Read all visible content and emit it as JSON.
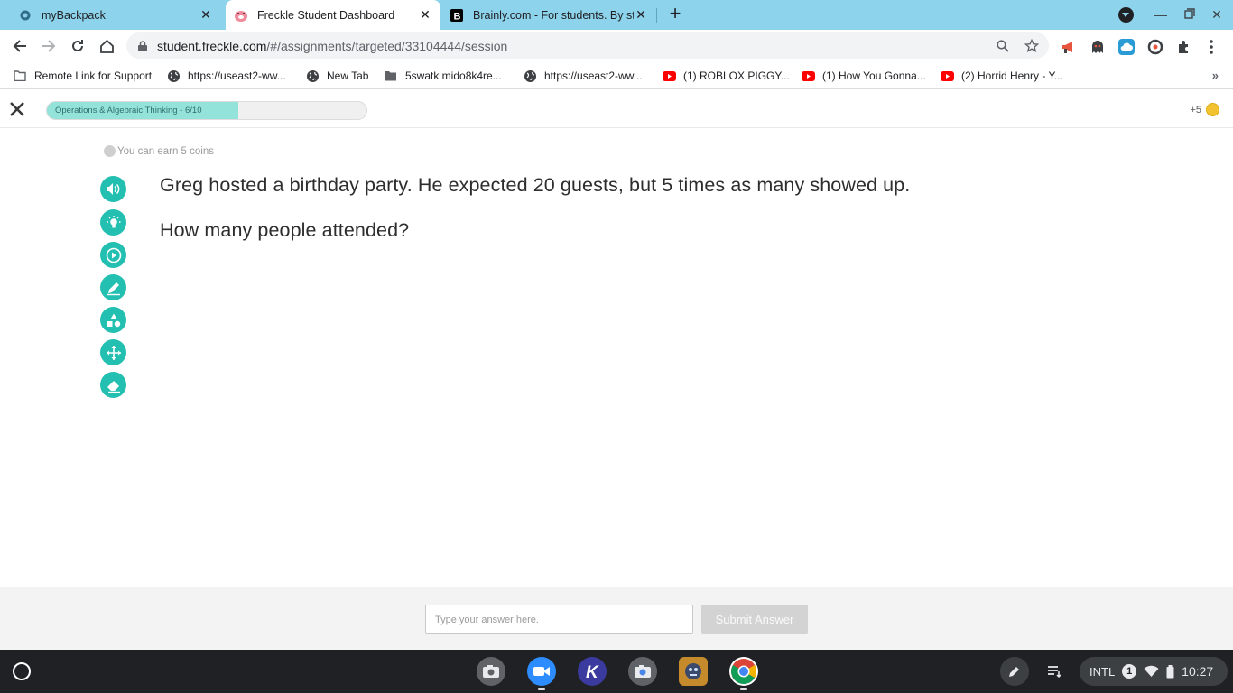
{
  "tabs": [
    {
      "title": "myBackpack",
      "icon": "backpack-favicon",
      "active": false
    },
    {
      "title": "Freckle Student Dashboard",
      "icon": "freckle-pig-favicon",
      "active": true
    },
    {
      "title": "Brainly.com - For students. By stu",
      "icon": "brainly-favicon",
      "active": false
    }
  ],
  "toolbar": {
    "url_host": "student.freckle.com",
    "url_path": "/#/assignments/targeted/33104444/session"
  },
  "bookmarks": [
    {
      "label": "Remote Link for Support",
      "icon": "folder-icon"
    },
    {
      "label": "https://useast2-ww...",
      "icon": "globe-icon"
    },
    {
      "label": "New Tab",
      "icon": "globe-icon"
    },
    {
      "label": "5swatk mido8k4re...",
      "icon": "folder-icon"
    },
    {
      "label": "https://useast2-ww...",
      "icon": "globe-icon"
    },
    {
      "label": "(1) ROBLOX PIGGY...",
      "icon": "youtube-icon"
    },
    {
      "label": "(1) How You Gonna...",
      "icon": "youtube-icon"
    },
    {
      "label": "(2) Horrid Henry - Y...",
      "icon": "youtube-icon"
    }
  ],
  "header": {
    "progress_label": "Operations & Algebraic Thinking - 6/10",
    "progress_fraction": 0.6,
    "coins_total": "+5"
  },
  "question": {
    "earn_text": "You can earn 5 coins",
    "line1": "Greg hosted a birthday party. He expected 20 guests, but 5 times as many showed up.",
    "line2": "How many people attended?"
  },
  "tools": [
    "speaker-icon",
    "hint-lightbulb-icon",
    "video-play-icon",
    "pencil-icon",
    "shapes-icon",
    "move-arrows-icon",
    "eraser-icon"
  ],
  "answer": {
    "placeholder": "Type your answer here.",
    "value": "",
    "submit_label": "Submit Answer"
  },
  "shelf": {
    "ime": "INTL",
    "notification_count": "1",
    "time": "10:27"
  },
  "colors": {
    "tabstrip": "#8ed3ec",
    "accent_teal": "#23bfb0",
    "progress_fill": "#94e3db",
    "coin": "#f2c230"
  }
}
